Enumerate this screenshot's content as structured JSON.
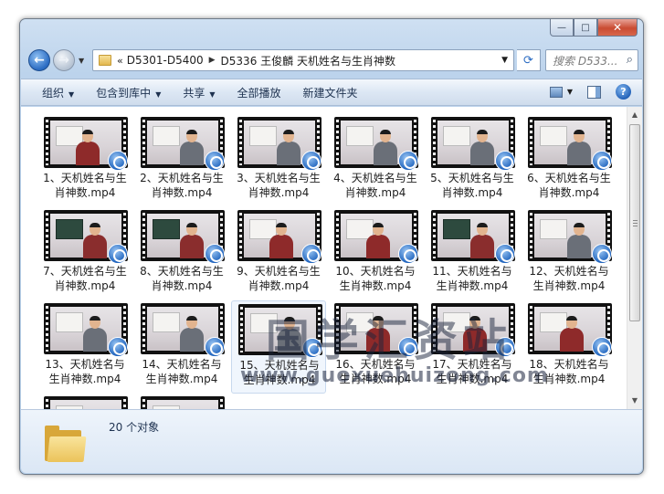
{
  "window": {
    "caption": {
      "minimize": "—",
      "maximize": "□",
      "close": "✕"
    }
  },
  "nav": {
    "back_icon": "←",
    "forward_icon": "→",
    "address": {
      "overflow": "«",
      "crumbs": [
        "D5301-D5400",
        "D5336 王俊麟 天机姓名与生肖神数"
      ]
    },
    "refresh_icon": "⟳",
    "search_placeholder": "搜索 D533...",
    "search_icon": "⌕"
  },
  "toolbar": {
    "items": [
      {
        "label": "组织",
        "dropdown": true
      },
      {
        "label": "包含到库中",
        "dropdown": true
      },
      {
        "label": "共享",
        "dropdown": true
      },
      {
        "label": "全部播放",
        "dropdown": false
      },
      {
        "label": "新建文件夹",
        "dropdown": false
      }
    ]
  },
  "files": [
    {
      "line1": "1、天机姓名与生",
      "line2": "肖神数.mp4",
      "scene": "red"
    },
    {
      "line1": "2、天机姓名与生",
      "line2": "肖神数.mp4",
      "scene": "gray"
    },
    {
      "line1": "3、天机姓名与生",
      "line2": "肖神数.mp4",
      "scene": "gray"
    },
    {
      "line1": "4、天机姓名与生",
      "line2": "肖神数.mp4",
      "scene": "gray"
    },
    {
      "line1": "5、天机姓名与生",
      "line2": "肖神数.mp4",
      "scene": "gray"
    },
    {
      "line1": "6、天机姓名与生",
      "line2": "肖神数.mp4",
      "scene": "gray"
    },
    {
      "line1": "7、天机姓名与生",
      "line2": "肖神数.mp4",
      "scene": "board"
    },
    {
      "line1": "8、天机姓名与生",
      "line2": "肖神数.mp4",
      "scene": "board"
    },
    {
      "line1": "9、天机姓名与生",
      "line2": "肖神数.mp4",
      "scene": "red"
    },
    {
      "line1": "10、天机姓名与",
      "line2": "生肖神数.mp4",
      "scene": "red"
    },
    {
      "line1": "11、天机姓名与",
      "line2": "生肖神数.mp4",
      "scene": "board"
    },
    {
      "line1": "12、天机姓名与",
      "line2": "生肖神数.mp4",
      "scene": "gray"
    },
    {
      "line1": "13、天机姓名与",
      "line2": "生肖神数.mp4",
      "scene": "gray"
    },
    {
      "line1": "14、天机姓名与",
      "line2": "生肖神数.mp4",
      "scene": "gray"
    },
    {
      "line1": "15、天机姓名与",
      "line2": "生肖神数.mp4",
      "scene": "gray"
    },
    {
      "line1": "16、天机姓名与",
      "line2": "生肖神数.mp4",
      "scene": "red"
    },
    {
      "line1": "17、天机姓名与",
      "line2": "生肖神数.mp4",
      "scene": "red"
    },
    {
      "line1": "18、天机姓名与",
      "line2": "生肖神数.mp4",
      "scene": "red"
    },
    {
      "line1": "",
      "line2": "",
      "scene": "gray"
    },
    {
      "line1": "",
      "line2": "",
      "scene": "gray"
    }
  ],
  "selected_index": 14,
  "watermark": {
    "title": "国学汇资站",
    "url": "www.guoxuehuizong.com"
  },
  "details": {
    "count": "20 个对象"
  },
  "colors": {
    "window_frame": "#bcd3ec",
    "toolbar_text": "#1e3250",
    "badge": "#1d62bd",
    "close_button": "#c94b32"
  }
}
